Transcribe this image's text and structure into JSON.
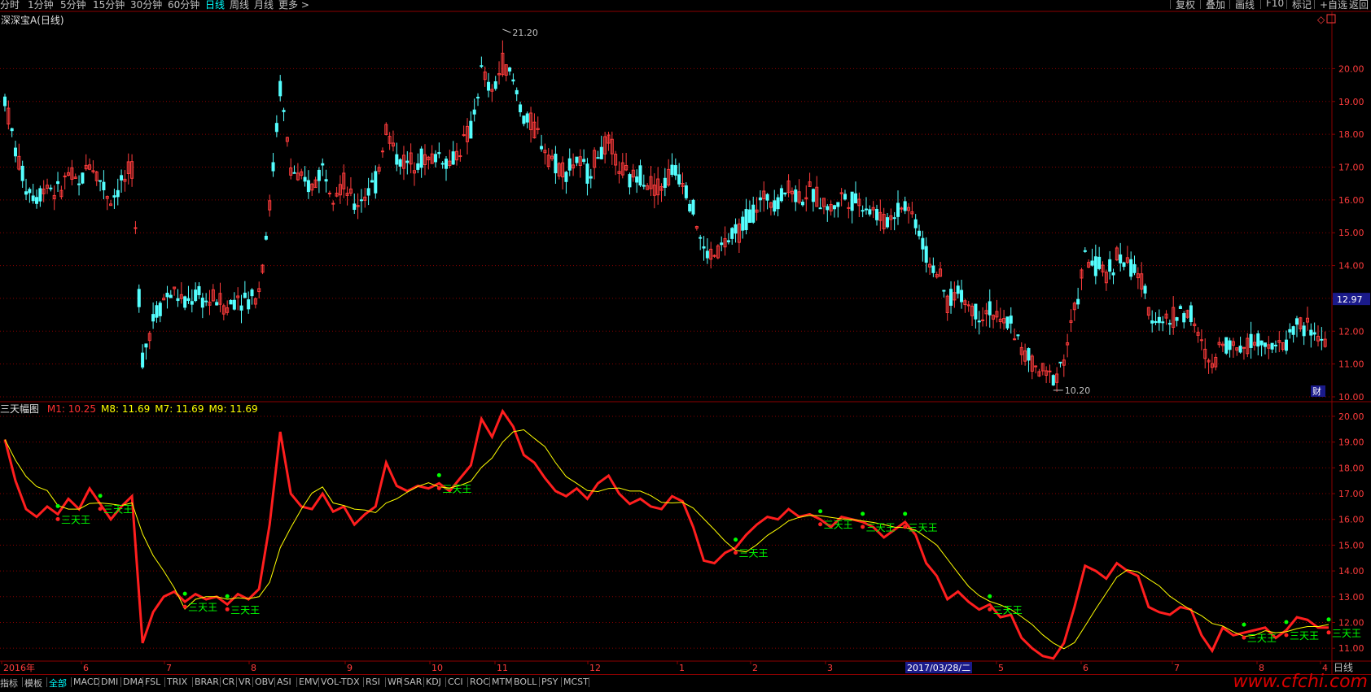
{
  "topbar": {
    "periods": [
      "分时",
      "1分钟",
      "5分钟",
      "15分钟",
      "30分钟",
      "60分钟",
      "日线",
      "周线",
      "月线",
      "更多 >"
    ],
    "active_period": "日线",
    "right_buttons": [
      "复权",
      "叠加",
      "画线",
      "F10",
      "标记",
      "+自选",
      "返回"
    ]
  },
  "stock": {
    "title": "深深宝A(日线)"
  },
  "price_panel": {
    "y_ticks": [
      "20.00",
      "19.00",
      "18.00",
      "17.00",
      "16.00",
      "15.00",
      "14.00",
      "13.00",
      "12.00",
      "11.00",
      "10.00"
    ],
    "current_price": "12.97",
    "high_label": "21.20",
    "low_label": "10.20",
    "marker": "财"
  },
  "indicator_panel": {
    "name": "三天幅图",
    "values": [
      {
        "label": "M1:",
        "value": "10.25",
        "color": "#ff3030"
      },
      {
        "label": "M8:",
        "value": "11.69",
        "color": "#ffff00"
      },
      {
        "label": "M7:",
        "value": "11.69",
        "color": "#ffff00"
      },
      {
        "label": "M9:",
        "value": "11.69",
        "color": "#ffff00"
      }
    ],
    "y_ticks": [
      "20.00",
      "19.00",
      "18.00",
      "17.00",
      "16.00",
      "15.00",
      "14.00",
      "13.00",
      "12.00",
      "11.00"
    ],
    "signal_text": "三天王"
  },
  "x_axis": {
    "labels": [
      "2016年",
      "6",
      "7",
      "8",
      "9",
      "10",
      "11",
      "12",
      "1",
      "2",
      "3",
      "2017/03/28/二",
      "5",
      "6",
      "7",
      "8",
      "4"
    ],
    "period_label": "日线"
  },
  "bottom_tabs": [
    "指标",
    "模板",
    "全部",
    "MACD",
    "DMI",
    "DMA",
    "FSL",
    "TRIX",
    "BRAR",
    "CR",
    "VR",
    "OBV",
    "ASI",
    "EMV",
    "VOL-TDX",
    "RSI",
    "WR",
    "SAR",
    "KDJ",
    "CCI",
    "ROC",
    "MTM",
    "BOLL",
    "PSY",
    "MCST"
  ],
  "active_tab": "全部",
  "watermark": "www.cfchi.com",
  "colors": {
    "up": "#ff3c3c",
    "down": "#54ffff",
    "ma": "#ffff00",
    "grid": "#8b0000",
    "signal_text": "#00ff00",
    "signal_dot_up": "#00ff00",
    "signal_dot_down": "#ff2020"
  },
  "chart_data": {
    "type": "candlestick",
    "title": "深深宝A(日线)",
    "ylim_price": [
      10.0,
      21.2
    ],
    "ylim_indicator": [
      10.5,
      20.0
    ],
    "months": [
      "2016-05",
      "2016-06",
      "2016-07",
      "2016-08",
      "2016-09",
      "2016-10",
      "2016-11",
      "2016-12",
      "2017-01",
      "2017-02",
      "2017-03",
      "2017-04",
      "2017-05",
      "2017-06",
      "2017-07",
      "2017-08",
      "2017-09"
    ],
    "close_trend": [
      19.1,
      17.5,
      16.4,
      16.1,
      16.5,
      16.2,
      16.8,
      16.4,
      17.2,
      16.6,
      16.0,
      16.5,
      16.9,
      11.2,
      12.4,
      13.0,
      13.2,
      12.8,
      13.1,
      12.9,
      13.0,
      12.7,
      13.1,
      12.9,
      13.3,
      15.8,
      19.4,
      17.0,
      16.5,
      16.4,
      17.0,
      16.3,
      16.5,
      15.8,
      16.2,
      16.5,
      18.2,
      17.3,
      17.1,
      17.3,
      17.2,
      17.4,
      17.1,
      17.6,
      18.1,
      19.9,
      19.2,
      20.2,
      19.6,
      18.5,
      18.2,
      17.6,
      17.1,
      16.9,
      17.2,
      16.8,
      17.4,
      17.7,
      17.0,
      16.6,
      16.8,
      16.5,
      16.4,
      16.9,
      16.7,
      15.7,
      14.4,
      14.3,
      14.7,
      14.9,
      15.4,
      15.8,
      16.1,
      16.0,
      16.4,
      16.1,
      16.2,
      16.0,
      15.7,
      16.1,
      16.0,
      15.9,
      15.7,
      15.3,
      15.6,
      15.9,
      15.4,
      14.3,
      13.8,
      12.9,
      13.2,
      12.8,
      12.5,
      12.7,
      12.2,
      12.3,
      11.4,
      11.0,
      10.7,
      10.6,
      11.2,
      12.6,
      14.2,
      14.0,
      13.7,
      14.3,
      14.0,
      13.8,
      12.6,
      12.4,
      12.3,
      12.6,
      12.5,
      11.5,
      10.9,
      11.8,
      11.5,
      11.6,
      11.7,
      11.8,
      11.4,
      11.7,
      12.2,
      12.1,
      11.8,
      11.8
    ]
  }
}
